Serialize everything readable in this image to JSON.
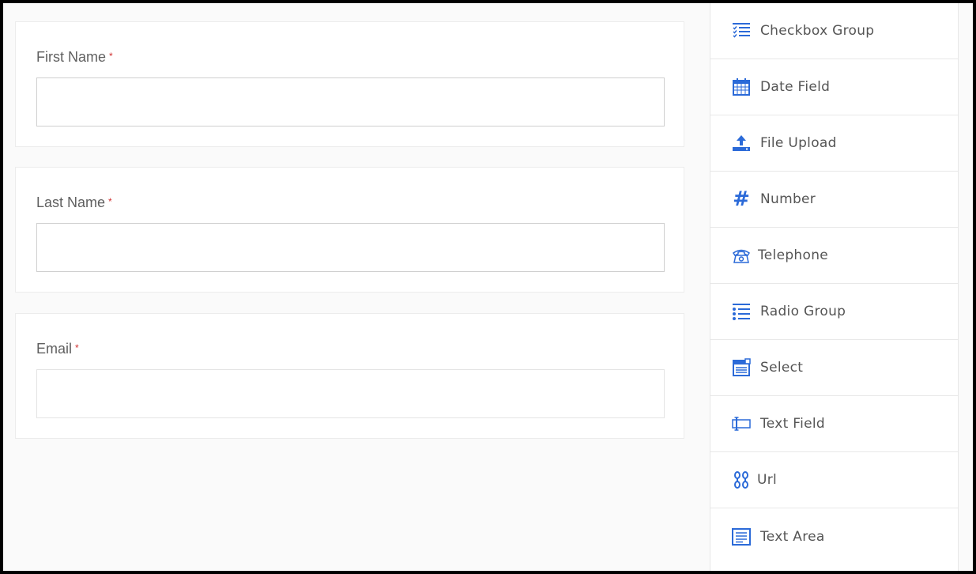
{
  "form": {
    "fields": [
      {
        "label": "First Name",
        "required_mark": "*",
        "value": ""
      },
      {
        "label": "Last Name",
        "required_mark": "*",
        "value": ""
      },
      {
        "label": "Email",
        "required_mark": "*",
        "value": ""
      }
    ]
  },
  "palette": {
    "items": [
      {
        "label": "Checkbox Group",
        "icon": "checkbox-group-icon"
      },
      {
        "label": "Date Field",
        "icon": "calendar-icon"
      },
      {
        "label": "File Upload",
        "icon": "upload-icon"
      },
      {
        "label": "Number",
        "icon": "hash-icon",
        "glyph": "#"
      },
      {
        "label": "Telephone",
        "icon": "telephone-icon"
      },
      {
        "label": "Radio Group",
        "icon": "radio-group-icon"
      },
      {
        "label": "Select",
        "icon": "select-icon"
      },
      {
        "label": "Text Field",
        "icon": "text-field-icon"
      },
      {
        "label": "Url",
        "icon": "link-icon"
      },
      {
        "label": "Text Area",
        "icon": "text-area-icon"
      }
    ]
  },
  "colors": {
    "accent": "#2b6ad8",
    "required": "#d03030",
    "label": "#5f5f5f",
    "background": "#fafafa"
  }
}
